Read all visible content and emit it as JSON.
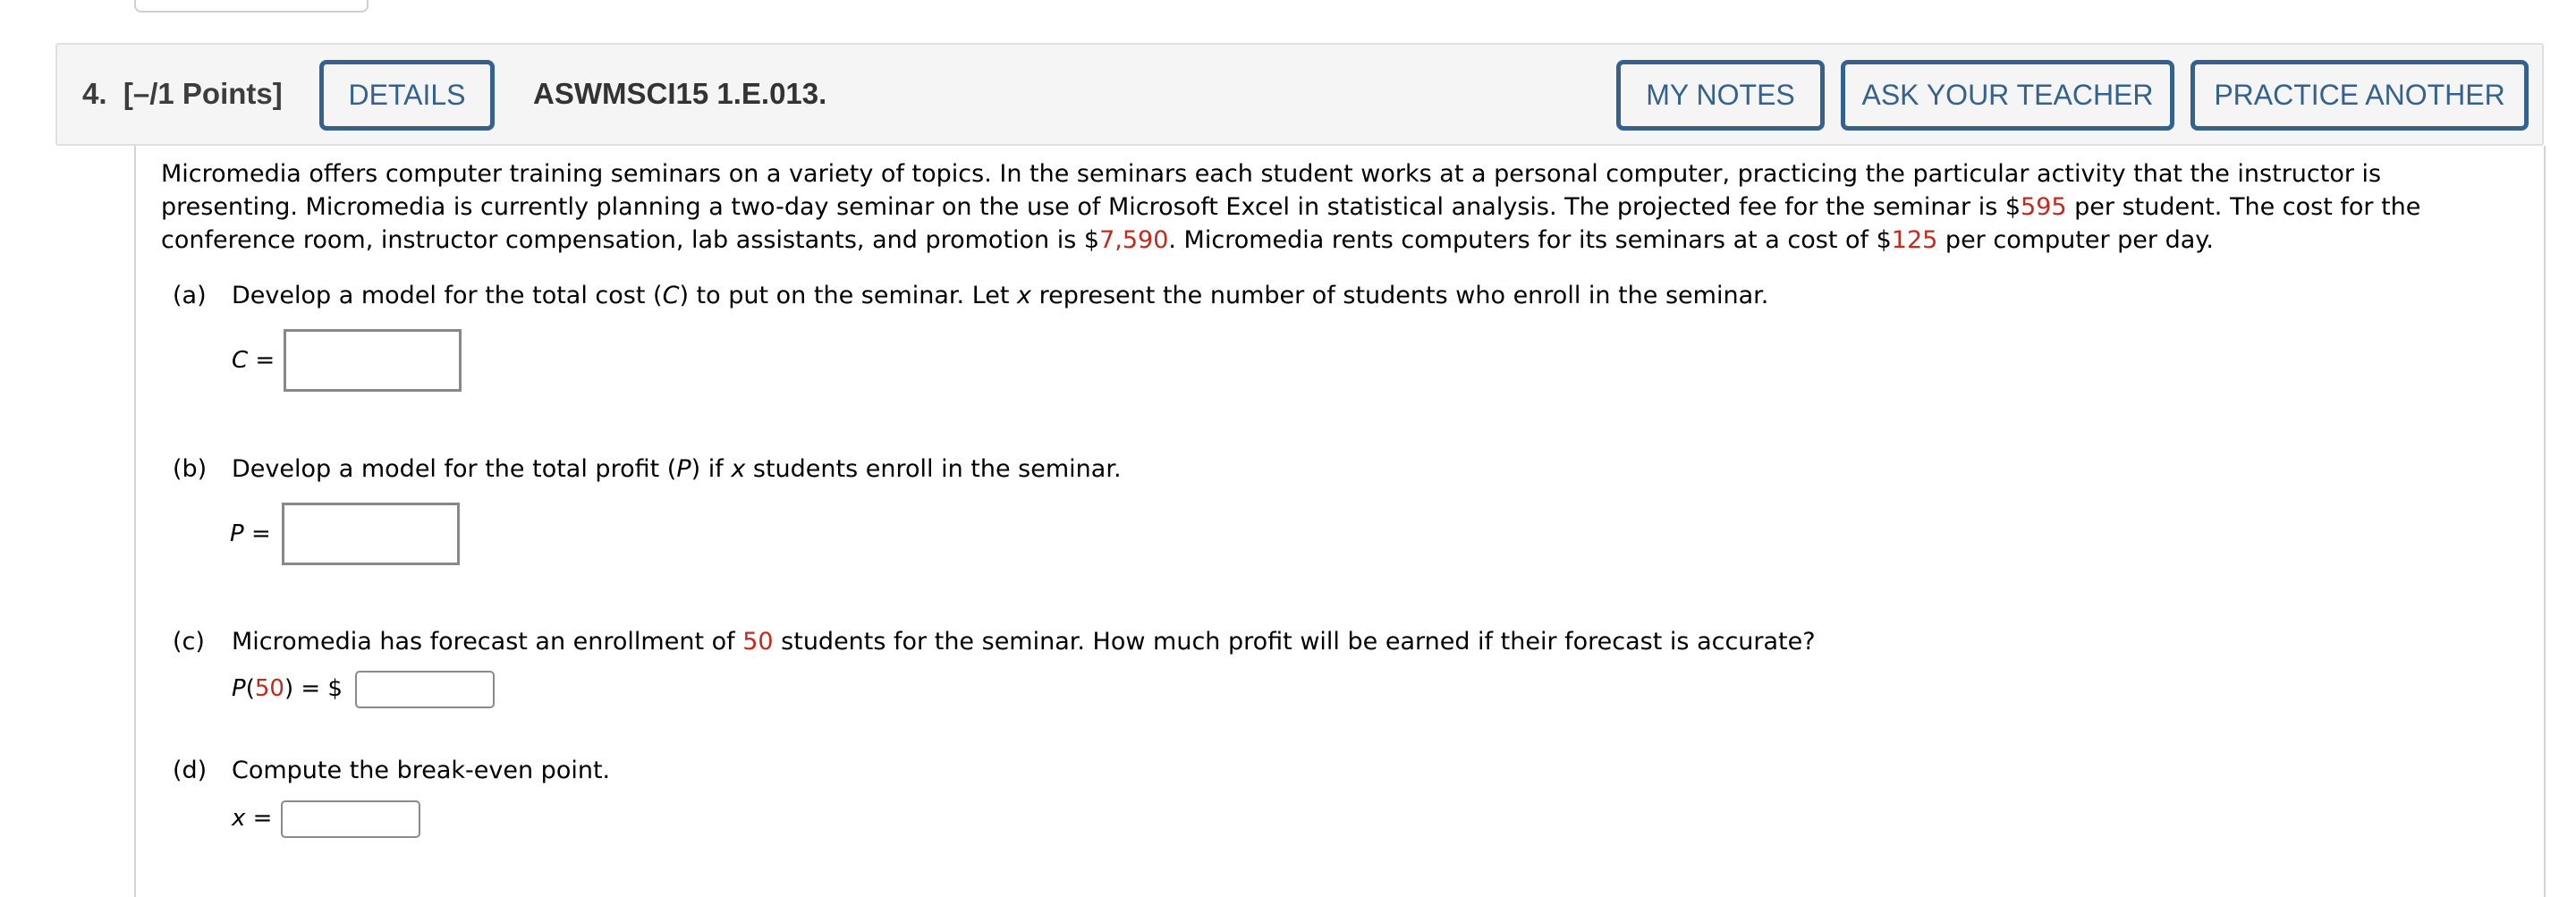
{
  "header": {
    "question_number": "4.",
    "points": "[–/1 Points]",
    "details_button": "DETAILS",
    "question_code": "ASWMSCI15 1.E.013.",
    "my_notes_button": "MY NOTES",
    "ask_teacher_button": "ASK YOUR TEACHER",
    "practice_another_button": "PRACTICE ANOTHER"
  },
  "colors": {
    "accent_blue": "#35618f",
    "highlight_red": "#c22a1e",
    "header_bg": "#f5f5f5"
  },
  "intro": {
    "text_1": "Micromedia offers computer training seminars on a variety of topics. In the seminars each student works at a personal computer, practicing the particular activity that the instructor is presenting. Micromedia is currently planning a two-day seminar on the use of Microsoft Excel in statistical analysis. The projected fee for the seminar is $",
    "fee": "595",
    "text_2": " per student. The cost for the conference room, instructor compensation, lab assistants, and promotion is $",
    "fixed_cost": "7,590",
    "text_3": ". Micromedia rents computers for its seminars at a cost of $",
    "computer_cost": "125",
    "text_4": " per computer per day."
  },
  "parts": {
    "a": {
      "label": "(a)",
      "text_1": "Develop a model for the total cost (",
      "var": "C",
      "text_2": ") to put on the seminar. Let ",
      "var2": "x",
      "text_3": " represent the number of students who enroll in the seminar.",
      "eq_var": "C",
      "eq_sign": " =",
      "answer": ""
    },
    "b": {
      "label": "(b)",
      "text_1": "Develop a model for the total profit (",
      "var": "P",
      "text_2": ") if ",
      "var2": "x",
      "text_3": " students enroll in the seminar.",
      "eq_var": "P",
      "eq_sign": " =",
      "answer": ""
    },
    "c": {
      "label": "(c)",
      "text_1": "Micromedia has forecast an enrollment of ",
      "enrollment": "50",
      "text_2": " students for the seminar. How much profit will be earned if their forecast is accurate?",
      "eq_var": "P",
      "eq_open": "(",
      "eq_arg": "50",
      "eq_close": ") = $",
      "answer": ""
    },
    "d": {
      "label": "(d)",
      "text_1": "Compute the break-even point.",
      "eq_var": "x",
      "eq_sign": " =",
      "answer": ""
    }
  }
}
